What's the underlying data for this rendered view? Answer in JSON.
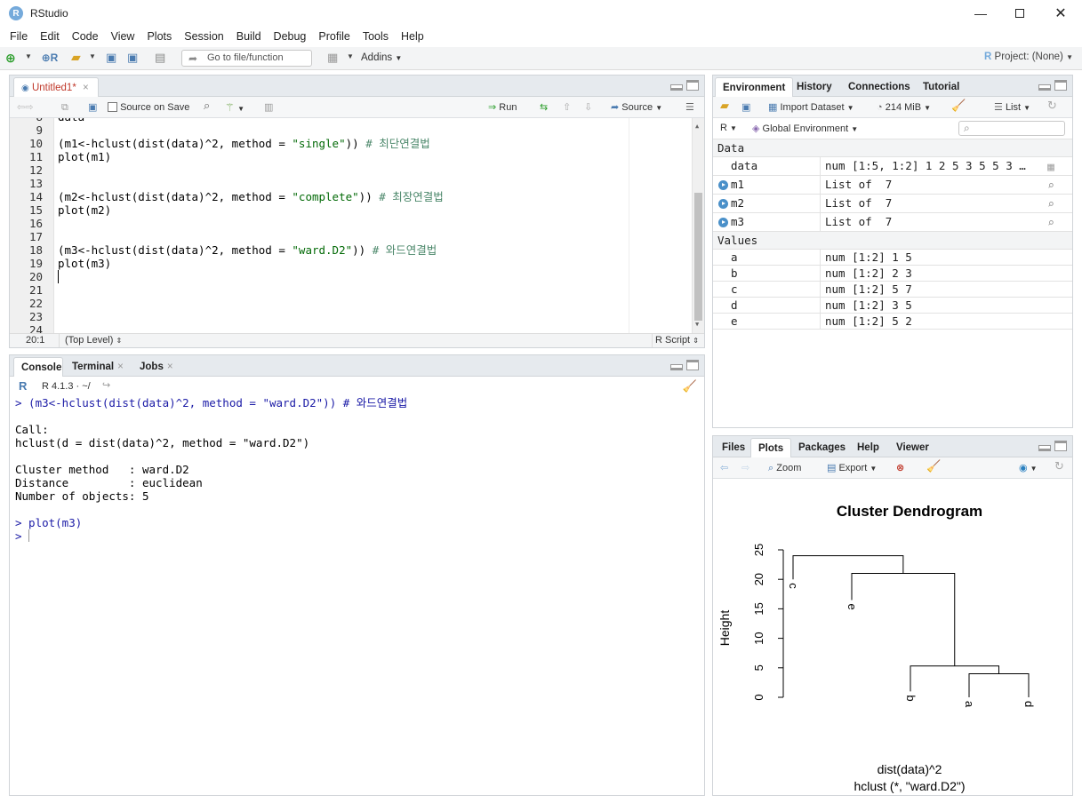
{
  "window": {
    "title": "RStudio",
    "icon_letter": "R"
  },
  "menu": [
    "File",
    "Edit",
    "Code",
    "View",
    "Plots",
    "Session",
    "Build",
    "Debug",
    "Profile",
    "Tools",
    "Help"
  ],
  "toolbar": {
    "goto_placeholder": "Go to file/function",
    "addins_label": "Addins",
    "project_label": "Project: (None)"
  },
  "editor": {
    "tab_label": "Untitled1*",
    "source_on_save": "Source on Save",
    "run_label": "Run",
    "source_label": "Source",
    "status_position": "20:1",
    "status_scope": "(Top Level)",
    "status_type": "R Script",
    "top_partial": "data",
    "line_numbers": [
      "9",
      "10",
      "11",
      "12",
      "13",
      "14",
      "15",
      "16",
      "17",
      "18",
      "19",
      "20",
      "21",
      "22",
      "23",
      "24"
    ],
    "lines": {
      "l10a": "(m1<-hclust(dist(data)^2, method = ",
      "l10s": "\"single\"",
      "l10b": ")) ",
      "l10c": "# 최단연결법",
      "l11": "plot(m1)",
      "l14a": "(m2<-hclust(dist(data)^2, method = ",
      "l14s": "\"complete\"",
      "l14b": ")) ",
      "l14c": "# 최장연결법",
      "l15": "plot(m2)",
      "l18a": "(m3<-hclust(dist(data)^2, method = ",
      "l18s": "\"ward.D2\"",
      "l18b": ")) ",
      "l18c": "# 와드연결법",
      "l19": "plot(m3)"
    }
  },
  "console": {
    "tabs": [
      "Console",
      "Terminal",
      "Jobs"
    ],
    "r_version": "R 4.1.3 · ~/",
    "lines": [
      "> (m3<-hclust(dist(data)^2, method = \"ward.D2\")) # 와드연결법",
      "",
      "Call:",
      "hclust(d = dist(data)^2, method = \"ward.D2\")",
      "",
      "Cluster method   : ward.D2",
      "Distance         : euclidean",
      "Number of objects: 5",
      "",
      "> plot(m3)",
      "> "
    ]
  },
  "environment": {
    "tabs": [
      "Environment",
      "History",
      "Connections",
      "Tutorial"
    ],
    "import_label": "Import Dataset",
    "memory": "214 MiB",
    "list_label": "List",
    "r_label": "R",
    "scope": "Global Environment",
    "section_data": "Data",
    "section_values": "Values",
    "data_rows": [
      {
        "name": "data",
        "value": "num [1:5, 1:2] 1 2 5 3 5 5 3 …"
      },
      {
        "name": "m1",
        "value": "List of  7"
      },
      {
        "name": "m2",
        "value": "List of  7"
      },
      {
        "name": "m3",
        "value": "List of  7"
      }
    ],
    "value_rows": [
      {
        "name": "a",
        "value": "num [1:2] 1 5"
      },
      {
        "name": "b",
        "value": "num [1:2] 2 3"
      },
      {
        "name": "c",
        "value": "num [1:2] 5 7"
      },
      {
        "name": "d",
        "value": "num [1:2] 3 5"
      },
      {
        "name": "e",
        "value": "num [1:2] 5 2"
      }
    ]
  },
  "files_pane": {
    "tabs": [
      "Files",
      "Plots",
      "Packages",
      "Help",
      "Viewer"
    ],
    "zoom_label": "Zoom",
    "export_label": "Export"
  },
  "chart_data": {
    "type": "dendrogram",
    "title": "Cluster Dendrogram",
    "ylabel": "Height",
    "xlabel": "dist(data)^2",
    "sub": "hclust (*, \"ward.D2\")",
    "ylim": [
      0,
      25
    ],
    "yticks": [
      "0",
      "5",
      "10",
      "15",
      "20",
      "25"
    ],
    "leaf_order": [
      "c",
      "e",
      "b",
      "a",
      "d"
    ],
    "merges": [
      {
        "left": "a",
        "right": "d",
        "height": 4
      },
      {
        "left": "b",
        "right": "a,d",
        "height": 5.3
      },
      {
        "left": "e",
        "right": "b,a,d",
        "height": 21
      },
      {
        "left": "c",
        "right": "e,b,a,d",
        "height": 24
      }
    ],
    "leaf_label_heights": {
      "c": 20,
      "e": 16.5,
      "b": 1,
      "a": 0,
      "d": 0
    }
  }
}
